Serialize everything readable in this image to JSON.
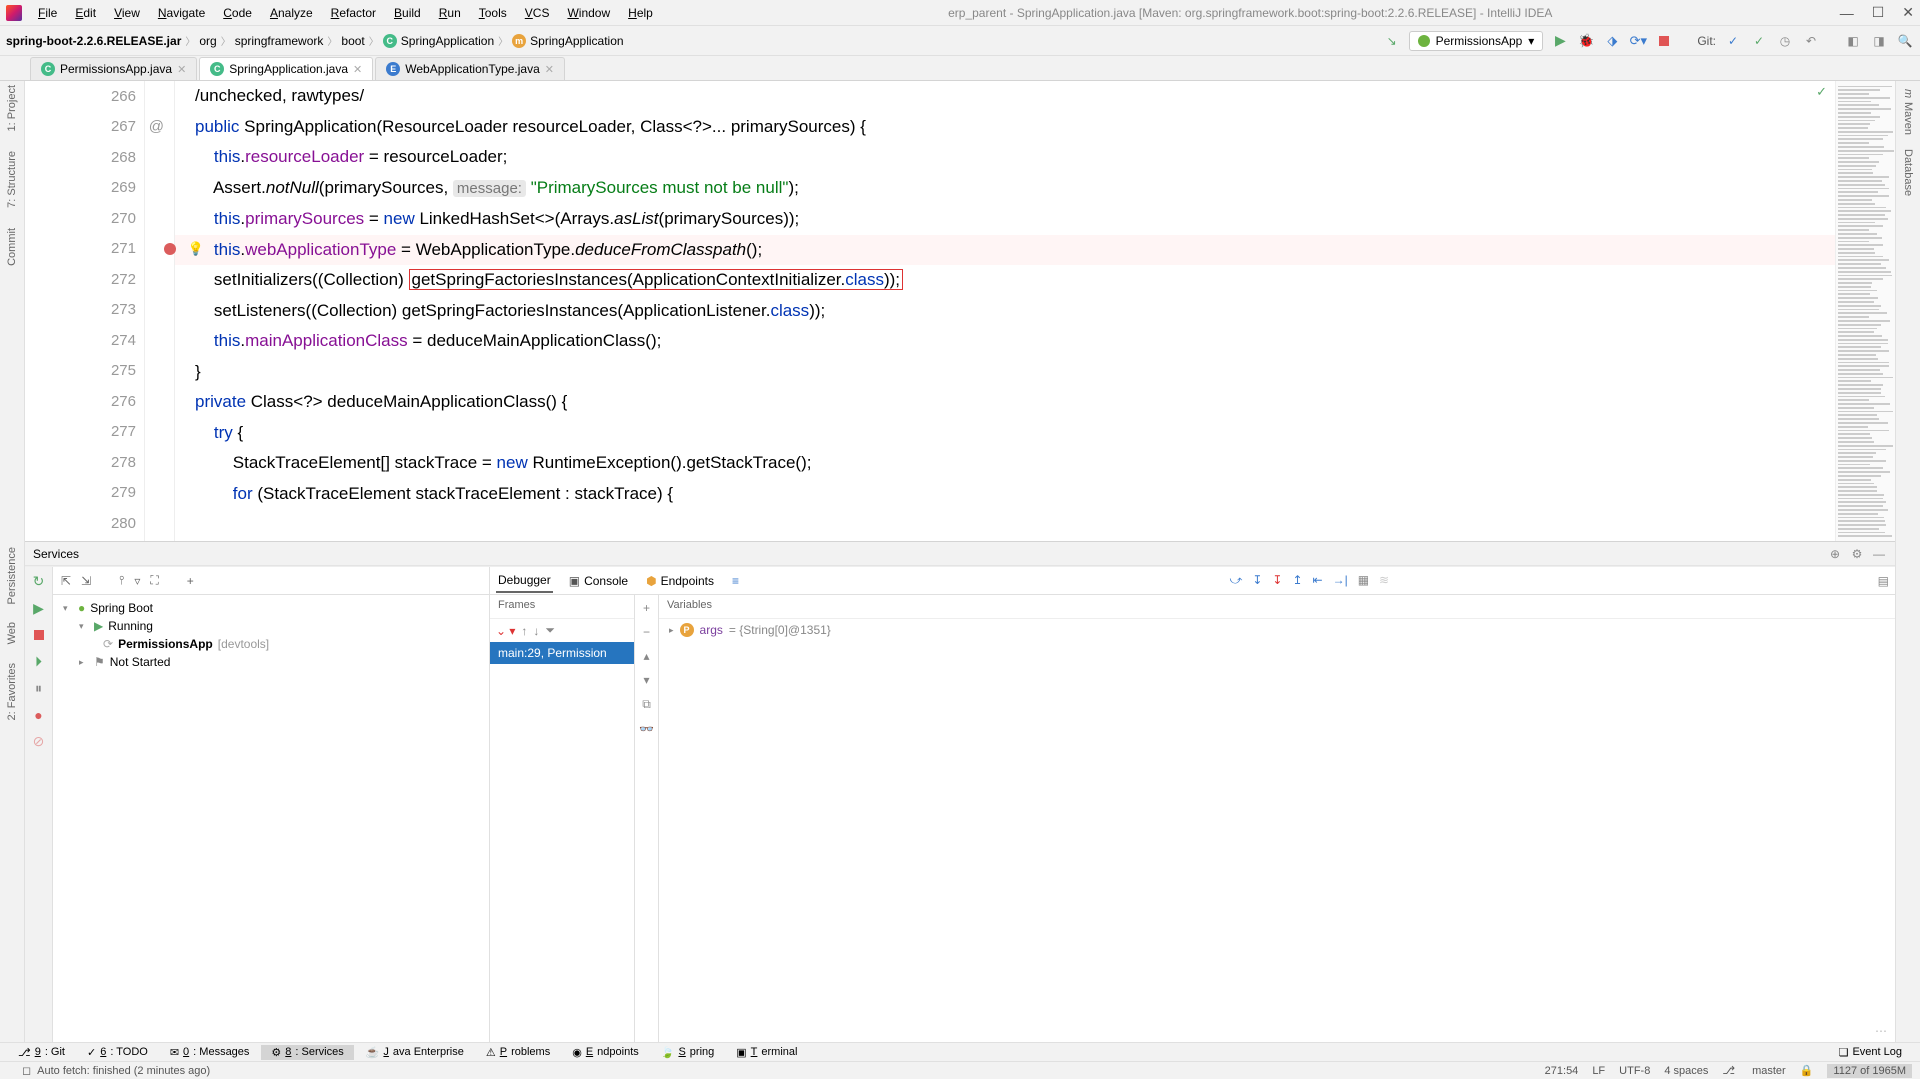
{
  "titlebar": {
    "menus": [
      "File",
      "Edit",
      "View",
      "Navigate",
      "Code",
      "Analyze",
      "Refactor",
      "Build",
      "Run",
      "Tools",
      "VCS",
      "Window",
      "Help"
    ],
    "title": "erp_parent - SpringApplication.java [Maven: org.springframework.boot:spring-boot:2.2.6.RELEASE] - IntelliJ IDEA"
  },
  "breadcrumb": {
    "jar": "spring-boot-2.2.6.RELEASE.jar",
    "parts": [
      "org",
      "springframework",
      "boot",
      "SpringApplication",
      "SpringApplication"
    ]
  },
  "run_config": "PermissionsApp",
  "git_label": "Git:",
  "editor_tabs": [
    {
      "label": "PermissionsApp.java",
      "icon": "c",
      "active": false
    },
    {
      "label": "SpringApplication.java",
      "icon": "c",
      "active": true
    },
    {
      "label": "WebApplicationType.java",
      "icon": "b",
      "active": false
    }
  ],
  "left_tools": [
    "1: Project",
    "7: Structure",
    "Commit"
  ],
  "right_tools": [
    "Maven",
    "Database"
  ],
  "gutter_start": 266,
  "code_lines": [
    {
      "n": 266,
      "html": "/unchecked, rawtypes/",
      "cls": "hl-top"
    },
    {
      "n": 267,
      "at": "@",
      "html": "<span class='kw'>public</span> SpringApplication(ResourceLoader resourceLoader, Class&lt;?&gt;... primarySources) {"
    },
    {
      "n": 268,
      "html": "    <span class='kw'>this</span>.<span class='fld'>resourceLoader</span> = resourceLoader;"
    },
    {
      "n": 269,
      "html": "    Assert.<span class='ital'>notNull</span>(primarySources, <span class='hint'>message:</span> <span class='str'>\"PrimarySources must not be null\"</span>);"
    },
    {
      "n": 270,
      "html": "    <span class='kw'>this</span>.<span class='fld'>primarySources</span> = <span class='kw'>new</span> LinkedHashSet&lt;&gt;(Arrays.<span class='ital'>asList</span>(primarySources));"
    },
    {
      "n": 271,
      "bp": true,
      "bulb": true,
      "hl": true,
      "html": "    <span class='kw'>this</span>.<span class='fld'>webApplicationType</span> = WebApplicationType.<span class='ital'>deduceFromClasspath</span>();"
    },
    {
      "n": 272,
      "html": "    setInitializers((Collection) <span class='redbox'>getSpringFactoriesInstances(ApplicationContextInitializer.<span class='kw'>class</span>));</span>"
    },
    {
      "n": 273,
      "html": "    setListeners((Collection) getSpringFactoriesInstances(ApplicationListener.<span class='kw'>class</span>));"
    },
    {
      "n": 274,
      "html": "    <span class='kw'>this</span>.<span class='fld'>mainApplicationClass</span> = deduceMainApplicationClass();"
    },
    {
      "n": 275,
      "html": "}"
    },
    {
      "n": 276,
      "html": ""
    },
    {
      "n": 277,
      "html": "<span class='kw'>private</span> Class&lt;?&gt; deduceMainApplicationClass() {"
    },
    {
      "n": 278,
      "html": "    <span class='kw'>try</span> {"
    },
    {
      "n": 279,
      "html": "        StackTraceElement[] stackTrace = <span class='kw'>new</span> RuntimeException().getStackTrace();"
    },
    {
      "n": 280,
      "html": "        <span class='kw'>for</span> (StackTraceElement stackTraceElement : stackTrace) {"
    }
  ],
  "services": {
    "title": "Services",
    "toolbar_left_icons": [
      "↻",
      "⇥",
      "≡",
      "⌄",
      "⌃",
      "⛶",
      "+"
    ],
    "tree": {
      "root": "Spring Boot",
      "running": "Running",
      "app": "PermissionsApp",
      "app_suffix": "[devtools]",
      "notstarted": "Not Started"
    },
    "debugger": {
      "tabs": [
        "Debugger",
        "Console",
        "Endpoints"
      ],
      "frames_label": "Frames",
      "frame": "main:29, Permission",
      "vars_label": "Variables",
      "var_name": "args",
      "var_val": " = {String[0]@1351}"
    }
  },
  "bottom_tools": [
    {
      "icon": "⎇",
      "label": "9: Git"
    },
    {
      "icon": "✓",
      "label": "6: TODO"
    },
    {
      "icon": "✉",
      "label": "0: Messages"
    },
    {
      "icon": "⚙",
      "label": "8: Services",
      "active": true
    },
    {
      "icon": "☕",
      "label": "Java Enterprise"
    },
    {
      "icon": "⚠",
      "label": "Problems"
    },
    {
      "icon": "◉",
      "label": "Endpoints"
    },
    {
      "icon": "🍃",
      "label": "Spring"
    },
    {
      "icon": "▣",
      "label": "Terminal"
    }
  ],
  "event_log": "Event Log",
  "status": {
    "msg": "Auto fetch: finished (2 minutes ago)",
    "pos": "271:54",
    "le": "LF",
    "enc": "UTF-8",
    "indent": "4 spaces",
    "branch": "master",
    "mem": "1127 of 1965M"
  }
}
